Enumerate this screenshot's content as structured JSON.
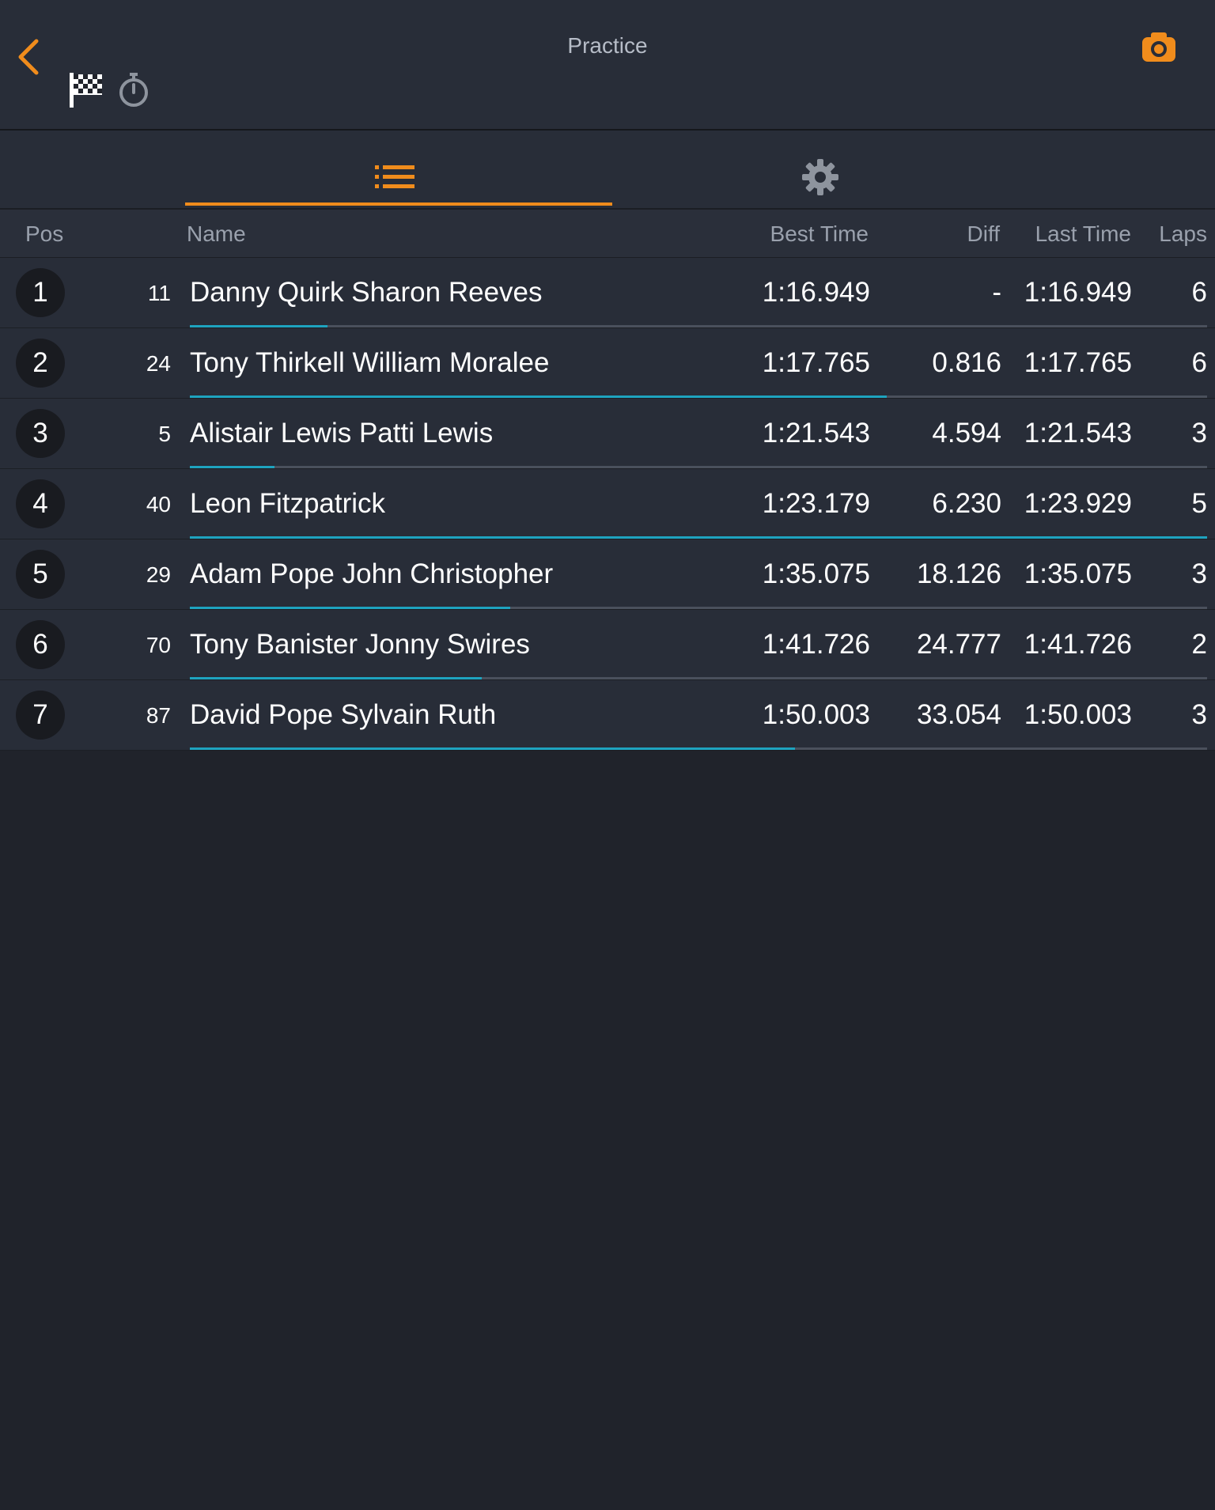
{
  "header": {
    "title": "Practice"
  },
  "icons": {
    "back": "chevron-left-icon",
    "flag": "checkered-flag-icon",
    "stopwatch": "stopwatch-icon",
    "camera": "camera-icon",
    "list": "list-icon",
    "settings": "gear-icon"
  },
  "colors": {
    "accent": "#f08c1c",
    "progress": "#1ea3bf",
    "background": "#20232b",
    "panel": "#282d38"
  },
  "tabs": {
    "active": "list"
  },
  "columns": {
    "pos": "Pos",
    "name": "Name",
    "best": "Best Time",
    "diff": "Diff",
    "last": "Last Time",
    "laps": "Laps"
  },
  "rows": [
    {
      "pos": "1",
      "num": "11",
      "name": "Danny Quirk Sharon Reeves",
      "best": "1:16.949",
      "diff": "-",
      "last": "1:16.949",
      "laps": "6",
      "progress": 0.135
    },
    {
      "pos": "2",
      "num": "24",
      "name": "Tony Thirkell William Moralee",
      "best": "1:17.765",
      "diff": "0.816",
      "last": "1:17.765",
      "laps": "6",
      "progress": 0.685
    },
    {
      "pos": "3",
      "num": "5",
      "name": "Alistair Lewis Patti Lewis",
      "best": "1:21.543",
      "diff": "4.594",
      "last": "1:21.543",
      "laps": "3",
      "progress": 0.083
    },
    {
      "pos": "4",
      "num": "40",
      "name": "Leon Fitzpatrick",
      "best": "1:23.179",
      "diff": "6.230",
      "last": "1:23.929",
      "laps": "5",
      "progress": 1.0
    },
    {
      "pos": "5",
      "num": "29",
      "name": "Adam Pope John Christopher",
      "best": "1:35.075",
      "diff": "18.126",
      "last": "1:35.075",
      "laps": "3",
      "progress": 0.315
    },
    {
      "pos": "6",
      "num": "70",
      "name": "Tony Banister Jonny Swires",
      "best": "1:41.726",
      "diff": "24.777",
      "last": "1:41.726",
      "laps": "2",
      "progress": 0.287
    },
    {
      "pos": "7",
      "num": "87",
      "name": "David Pope Sylvain Ruth",
      "best": "1:50.003",
      "diff": "33.054",
      "last": "1:50.003",
      "laps": "3",
      "progress": 0.595
    }
  ]
}
